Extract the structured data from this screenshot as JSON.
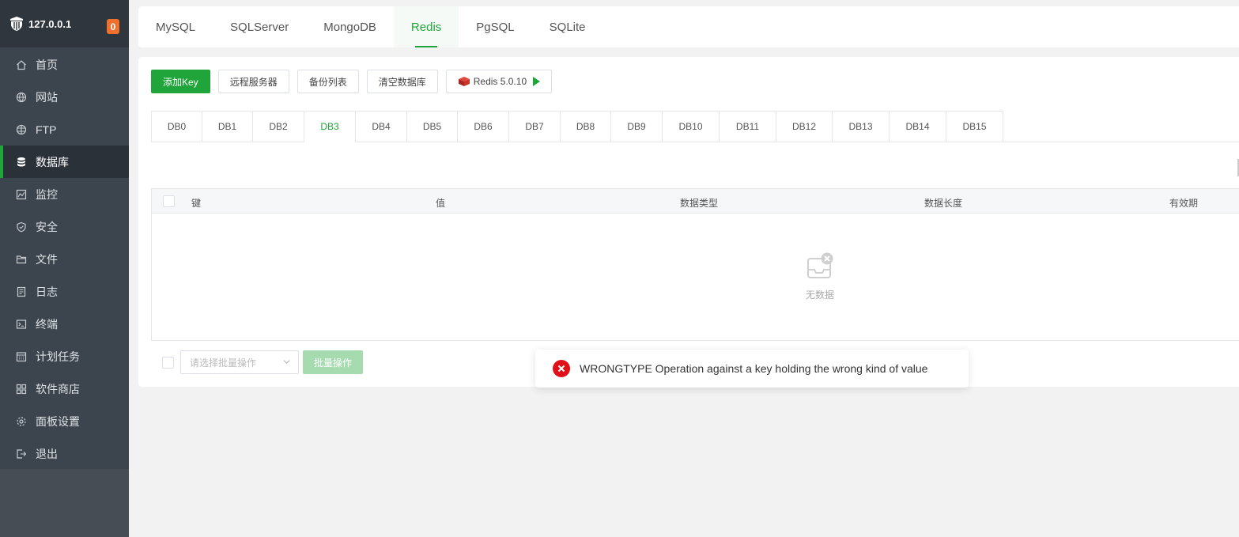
{
  "sidebar": {
    "host": "127.0.0.1",
    "badge": "0",
    "items": [
      {
        "label": "首页",
        "icon": "home-icon"
      },
      {
        "label": "网站",
        "icon": "globe-icon"
      },
      {
        "label": "FTP",
        "icon": "ftp-globe-icon"
      },
      {
        "label": "数据库",
        "icon": "database-icon",
        "active": true
      },
      {
        "label": "监控",
        "icon": "monitor-chart-icon"
      },
      {
        "label": "安全",
        "icon": "shield-icon"
      },
      {
        "label": "文件",
        "icon": "folder-icon"
      },
      {
        "label": "日志",
        "icon": "log-icon"
      },
      {
        "label": "终端",
        "icon": "terminal-icon"
      },
      {
        "label": "计划任务",
        "icon": "calendar-icon"
      },
      {
        "label": "软件商店",
        "icon": "apps-icon"
      },
      {
        "label": "面板设置",
        "icon": "gear-icon"
      },
      {
        "label": "退出",
        "icon": "logout-icon"
      }
    ]
  },
  "top_tabs": {
    "items": [
      "MySQL",
      "SQLServer",
      "MongoDB",
      "Redis",
      "PgSQL",
      "SQLite"
    ],
    "active": "Redis"
  },
  "toolbar": {
    "add_key": "添加Key",
    "remote_servers": "远程服务器",
    "backup_list": "备份列表",
    "clear_db": "清空数据库",
    "redis_version": "Redis 5.0.10"
  },
  "db_tabs": {
    "items": [
      "DB0",
      "DB1",
      "DB2",
      "DB3",
      "DB4",
      "DB5",
      "DB6",
      "DB7",
      "DB8",
      "DB9",
      "DB10",
      "DB11",
      "DB12",
      "DB13",
      "DB14",
      "DB15"
    ],
    "active": "DB3"
  },
  "table": {
    "columns": {
      "key": "键",
      "value": "值",
      "type": "数据类型",
      "length": "数据长度",
      "ttl": "有效期"
    },
    "empty_text": "无数据"
  },
  "batch": {
    "placeholder": "请选择批量操作",
    "button": "批量操作"
  },
  "toast": {
    "message": "WRONGTYPE Operation against a key holding the wrong kind of value",
    "type": "error"
  },
  "colors": {
    "accent": "#20a53a",
    "sidebar_bg": "#3c444d",
    "badge": "#f0712e",
    "error": "#e0101b"
  }
}
